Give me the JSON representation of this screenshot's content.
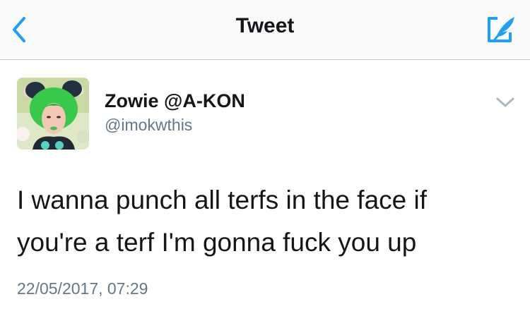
{
  "nav": {
    "title": "Tweet",
    "back_icon": "chevron-left-icon",
    "compose_icon": "compose-tweet-icon",
    "accent_color": "#1da1f2"
  },
  "tweet": {
    "display_name": "Zowie @A-KON",
    "handle": "@imokwthis",
    "avatar": "profile-photo",
    "menu_icon": "chevron-down-icon",
    "text_line1": "I wanna punch all terfs in the face if",
    "text_line2": "you're a terf I'm gonna fuck you up",
    "timestamp": "22/05/2017, 07:29"
  },
  "colors": {
    "text": "#14171a",
    "secondary": "#657786",
    "divider": "#c8c7cc"
  }
}
